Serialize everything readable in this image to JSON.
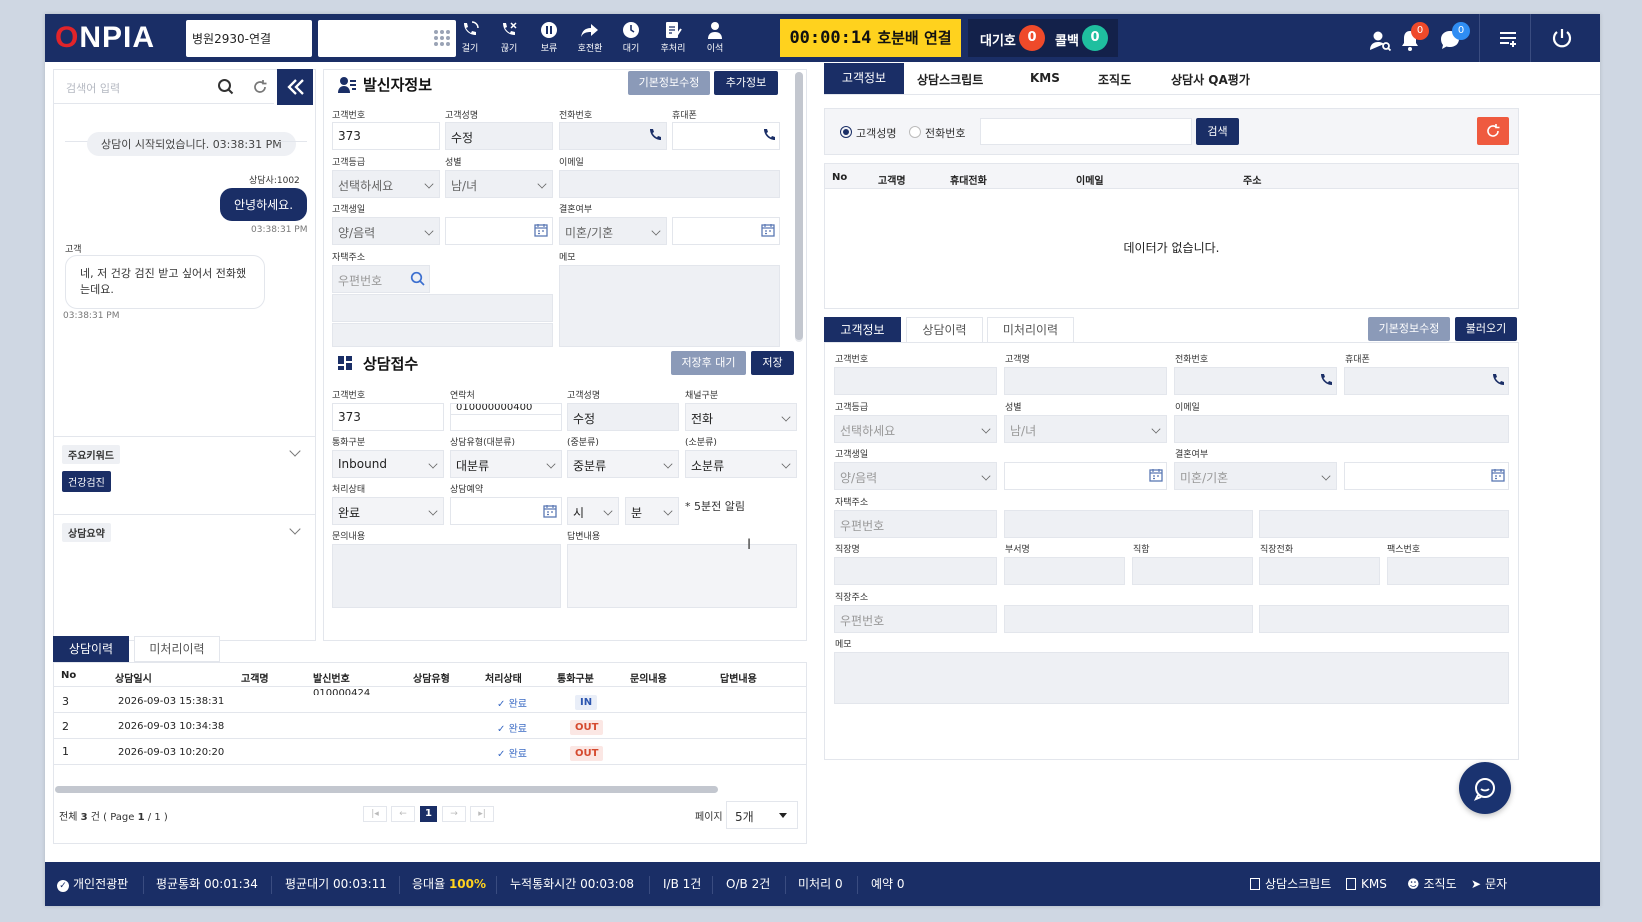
{
  "topbar": {
    "logo": "ONPIA",
    "line_name": "병원2930-연결",
    "buttons": [
      {
        "key": "call",
        "label": "걸기"
      },
      {
        "key": "hangup",
        "label": "끊기"
      },
      {
        "key": "hold",
        "label": "보류"
      },
      {
        "key": "transfer",
        "label": "호전환"
      },
      {
        "key": "wait",
        "label": "대기"
      },
      {
        "key": "after",
        "label": "후처리"
      },
      {
        "key": "away",
        "label": "이석"
      }
    ],
    "timer": "00:00:14",
    "timer_status": "호분배 연결",
    "queue_label": "대기호",
    "queue_count": "0",
    "callback_label": "콜백",
    "callback_count": "0",
    "notif_count": "0",
    "chat_count": "0",
    "colors": {
      "navy": "#1a2e66",
      "yellow": "#ffd21e",
      "red": "#ef4a2a",
      "teal": "#1fbf9f",
      "blue": "#2f8df3"
    }
  },
  "chat": {
    "search_placeholder": "검색어 입력",
    "start_msg": "상담이 시작되었습니다. 03:38:31 PM",
    "agent_label": "상담사:1002",
    "agent_msg": "안녕하세요.",
    "agent_time": "03:38:31 PM",
    "customer_label": "고객",
    "customer_msg": "네, 저 건강 검진 받고 싶어서 전화했는데요.",
    "customer_time": "03:38:31 PM",
    "keywords_title": "주요키워드",
    "keyword": "건강검진",
    "summary_title": "상담요약"
  },
  "caller": {
    "title": "발신자정보",
    "btn_edit": "기본정보수정",
    "btn_more": "추가정보",
    "labels": {
      "cust_no": "고객번호",
      "cust_name": "고객성명",
      "phone": "전화번호",
      "mobile": "휴대폰",
      "grade": "고객등급",
      "gender": "성별",
      "email": "이메일",
      "birth": "고객생일",
      "married": "결혼여부",
      "address": "자택주소",
      "memo": "메모"
    },
    "values": {
      "cust_no": "373",
      "cust_name": "수정",
      "grade": "선택하세요",
      "gender": "남/녀",
      "birth": "양/음력",
      "married": "미혼/기혼",
      "zip": "우편번호"
    }
  },
  "reception": {
    "title": "상담접수",
    "btn_save_wait": "저장후 대기",
    "btn_save": "저장",
    "labels": {
      "cust_no": "고객번호",
      "contact": "연락처",
      "cust_name": "고객성명",
      "channel": "채널구분",
      "call_type": "통화구분",
      "type_l": "상담유형(대분류)",
      "type_m": "(중분류)",
      "type_s": "(소분류)",
      "status": "처리상태",
      "reserve": "상담예약",
      "inquiry": "문의내용",
      "answer": "답변내용"
    },
    "values": {
      "cust_no": "373",
      "contact": "010000000400",
      "cust_name": "수정",
      "channel": "전화",
      "call_type": "Inbound",
      "type_l": "대분류",
      "type_m": "중분류",
      "type_s": "소분류",
      "status": "완료",
      "hour": "시",
      "minute": "분",
      "alarm": "* 5분전 알림"
    }
  },
  "history": {
    "tabs": [
      "상담이력",
      "미처리이력"
    ],
    "columns": [
      "No",
      "상담일시",
      "고객명",
      "발신번호",
      "상담유형",
      "처리상태",
      "통화구분",
      "문의내용",
      "답변내용"
    ],
    "rows": [
      {
        "no": "3",
        "date": "2026-09-03 15:38:31",
        "caller": "010000424",
        "status": "완료",
        "type": "IN"
      },
      {
        "no": "2",
        "date": "2026-09-03 10:34:38",
        "caller": "",
        "status": "완료",
        "type": "OUT"
      },
      {
        "no": "1",
        "date": "2026-09-03 10:20:20",
        "caller": "",
        "status": "완료",
        "type": "OUT"
      }
    ],
    "total_prefix": "전체",
    "total_count": "3",
    "total_suffix": "건 ( Page",
    "page_current": "1",
    "page_sep": "/",
    "page_total": "1",
    "page_close": ")",
    "current_page": "1",
    "page_size_label": "페이지",
    "page_size": "5개"
  },
  "right": {
    "tabs": [
      "고객정보",
      "상담스크립트",
      "KMS",
      "조직도",
      "상담사 QA평가"
    ],
    "radio_name": "고객성명",
    "radio_phone": "전화번호",
    "search_btn": "검색",
    "list_columns": [
      "No",
      "고객명",
      "휴대전화",
      "이메일",
      "주소"
    ],
    "empty_msg": "데이터가 없습니다.",
    "sub_tabs": [
      "고객정보",
      "상담이력",
      "미처리이력"
    ],
    "btn_edit": "기본정보수정",
    "btn_load": "불러오기",
    "labels": {
      "cust_no": "고객번호",
      "cust_name": "고객명",
      "phone": "전화번호",
      "mobile": "휴대폰",
      "grade": "고객등급",
      "gender": "성별",
      "email": "이메일",
      "birth": "고객생일",
      "married": "결혼여부",
      "address": "자택주소",
      "company": "직장명",
      "dept": "부서명",
      "position": "직함",
      "work_phone": "직장전화",
      "fax": "팩스번호",
      "work_address": "직장주소",
      "memo": "메모"
    },
    "values": {
      "grade": "선택하세요",
      "gender": "남/녀",
      "birth": "양/음력",
      "married": "미혼/기혼",
      "zip": "우편번호"
    }
  },
  "bottombar": {
    "dashboard": "개인전광판",
    "avg_call_label": "평균통화",
    "avg_call": "00:01:34",
    "avg_wait_label": "평균대기",
    "avg_wait": "00:03:11",
    "answer_rate_label": "응대율",
    "answer_rate": "100%",
    "total_time_label": "누적통화시간",
    "total_time": "00:03:08",
    "ib_label": "I/B",
    "ib": "1건",
    "ob_label": "O/B",
    "ob": "2건",
    "pending_label": "미처리",
    "pending": "0",
    "reserve_label": "예약",
    "reserve": "0",
    "links": [
      "상담스크립트",
      "KMS",
      "조직도",
      "문자"
    ]
  }
}
